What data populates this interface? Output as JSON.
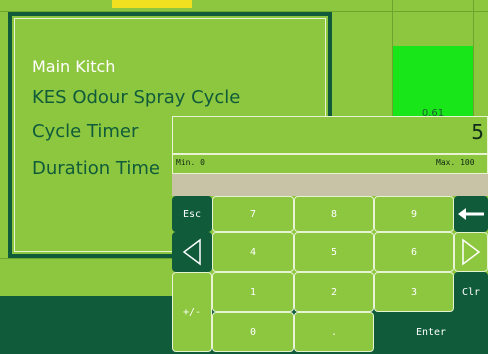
{
  "panel": {
    "line1": "Main Kitch",
    "line2": "KES Odour Spray Cycle",
    "line3": "Cycle Timer",
    "line4": "Duration Time"
  },
  "bar": {
    "value": "0.61",
    "fill_color": "#19e619"
  },
  "keypad": {
    "display_value": "5",
    "min_label": "Min. 0",
    "max_label": "Max. 100",
    "keys": {
      "esc": "Esc",
      "k7": "7",
      "k8": "8",
      "k9": "9",
      "k4": "4",
      "k5": "5",
      "k6": "6",
      "k1": "1",
      "k2": "2",
      "k3": "3",
      "k0": "0",
      "dot": ".",
      "plusminus": "+/-",
      "clr": "Clr",
      "enter": "Enter"
    },
    "icons": {
      "backspace": "backspace-arrow-icon",
      "left": "left-triangle-icon",
      "right": "right-triangle-icon"
    }
  },
  "colors": {
    "background": "#8dc63f",
    "dark": "#0f5b3a",
    "accent": "#f0e020"
  }
}
